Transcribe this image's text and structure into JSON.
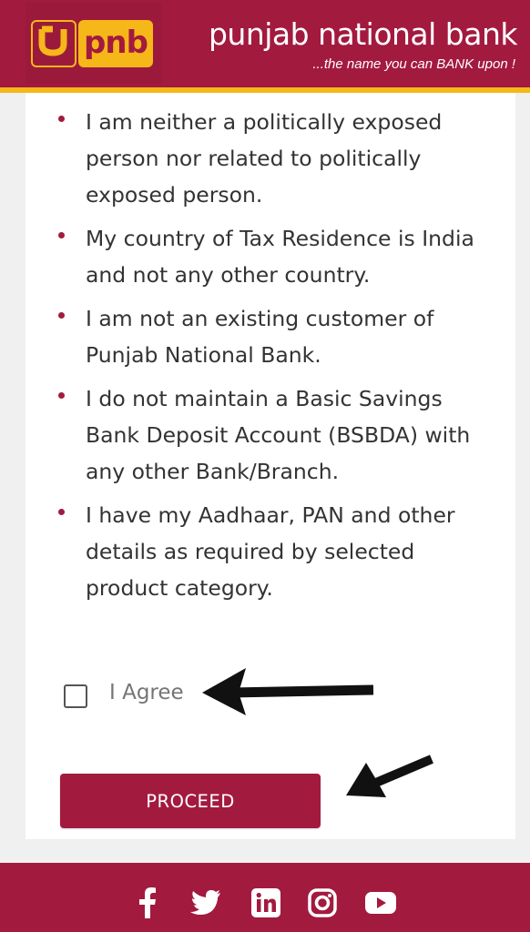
{
  "header": {
    "logo_text": "pnb",
    "bank_name": "punjab national bank",
    "tagline": "...the name you can BANK upon !"
  },
  "conditions": [
    "I am neither a politically exposed person nor related to politically exposed person.",
    "My country of Tax Residence is India and not any other country.",
    "I am not an existing customer of Punjab National Bank.",
    "I do not maintain a Basic Savings Bank Deposit Account (BSBDA) with any other Bank/Branch.",
    "I have my Aadhaar, PAN and other details as required by selected product category."
  ],
  "agree": {
    "label": "I Agree",
    "checked": false
  },
  "proceed_label": "PROCEED",
  "footer": {
    "social_icons": [
      "facebook-icon",
      "twitter-icon",
      "linkedin-icon",
      "instagram-icon",
      "youtube-icon"
    ]
  },
  "colors": {
    "brand": "#a31a3f",
    "accent": "#f6b719",
    "text": "#333333"
  }
}
